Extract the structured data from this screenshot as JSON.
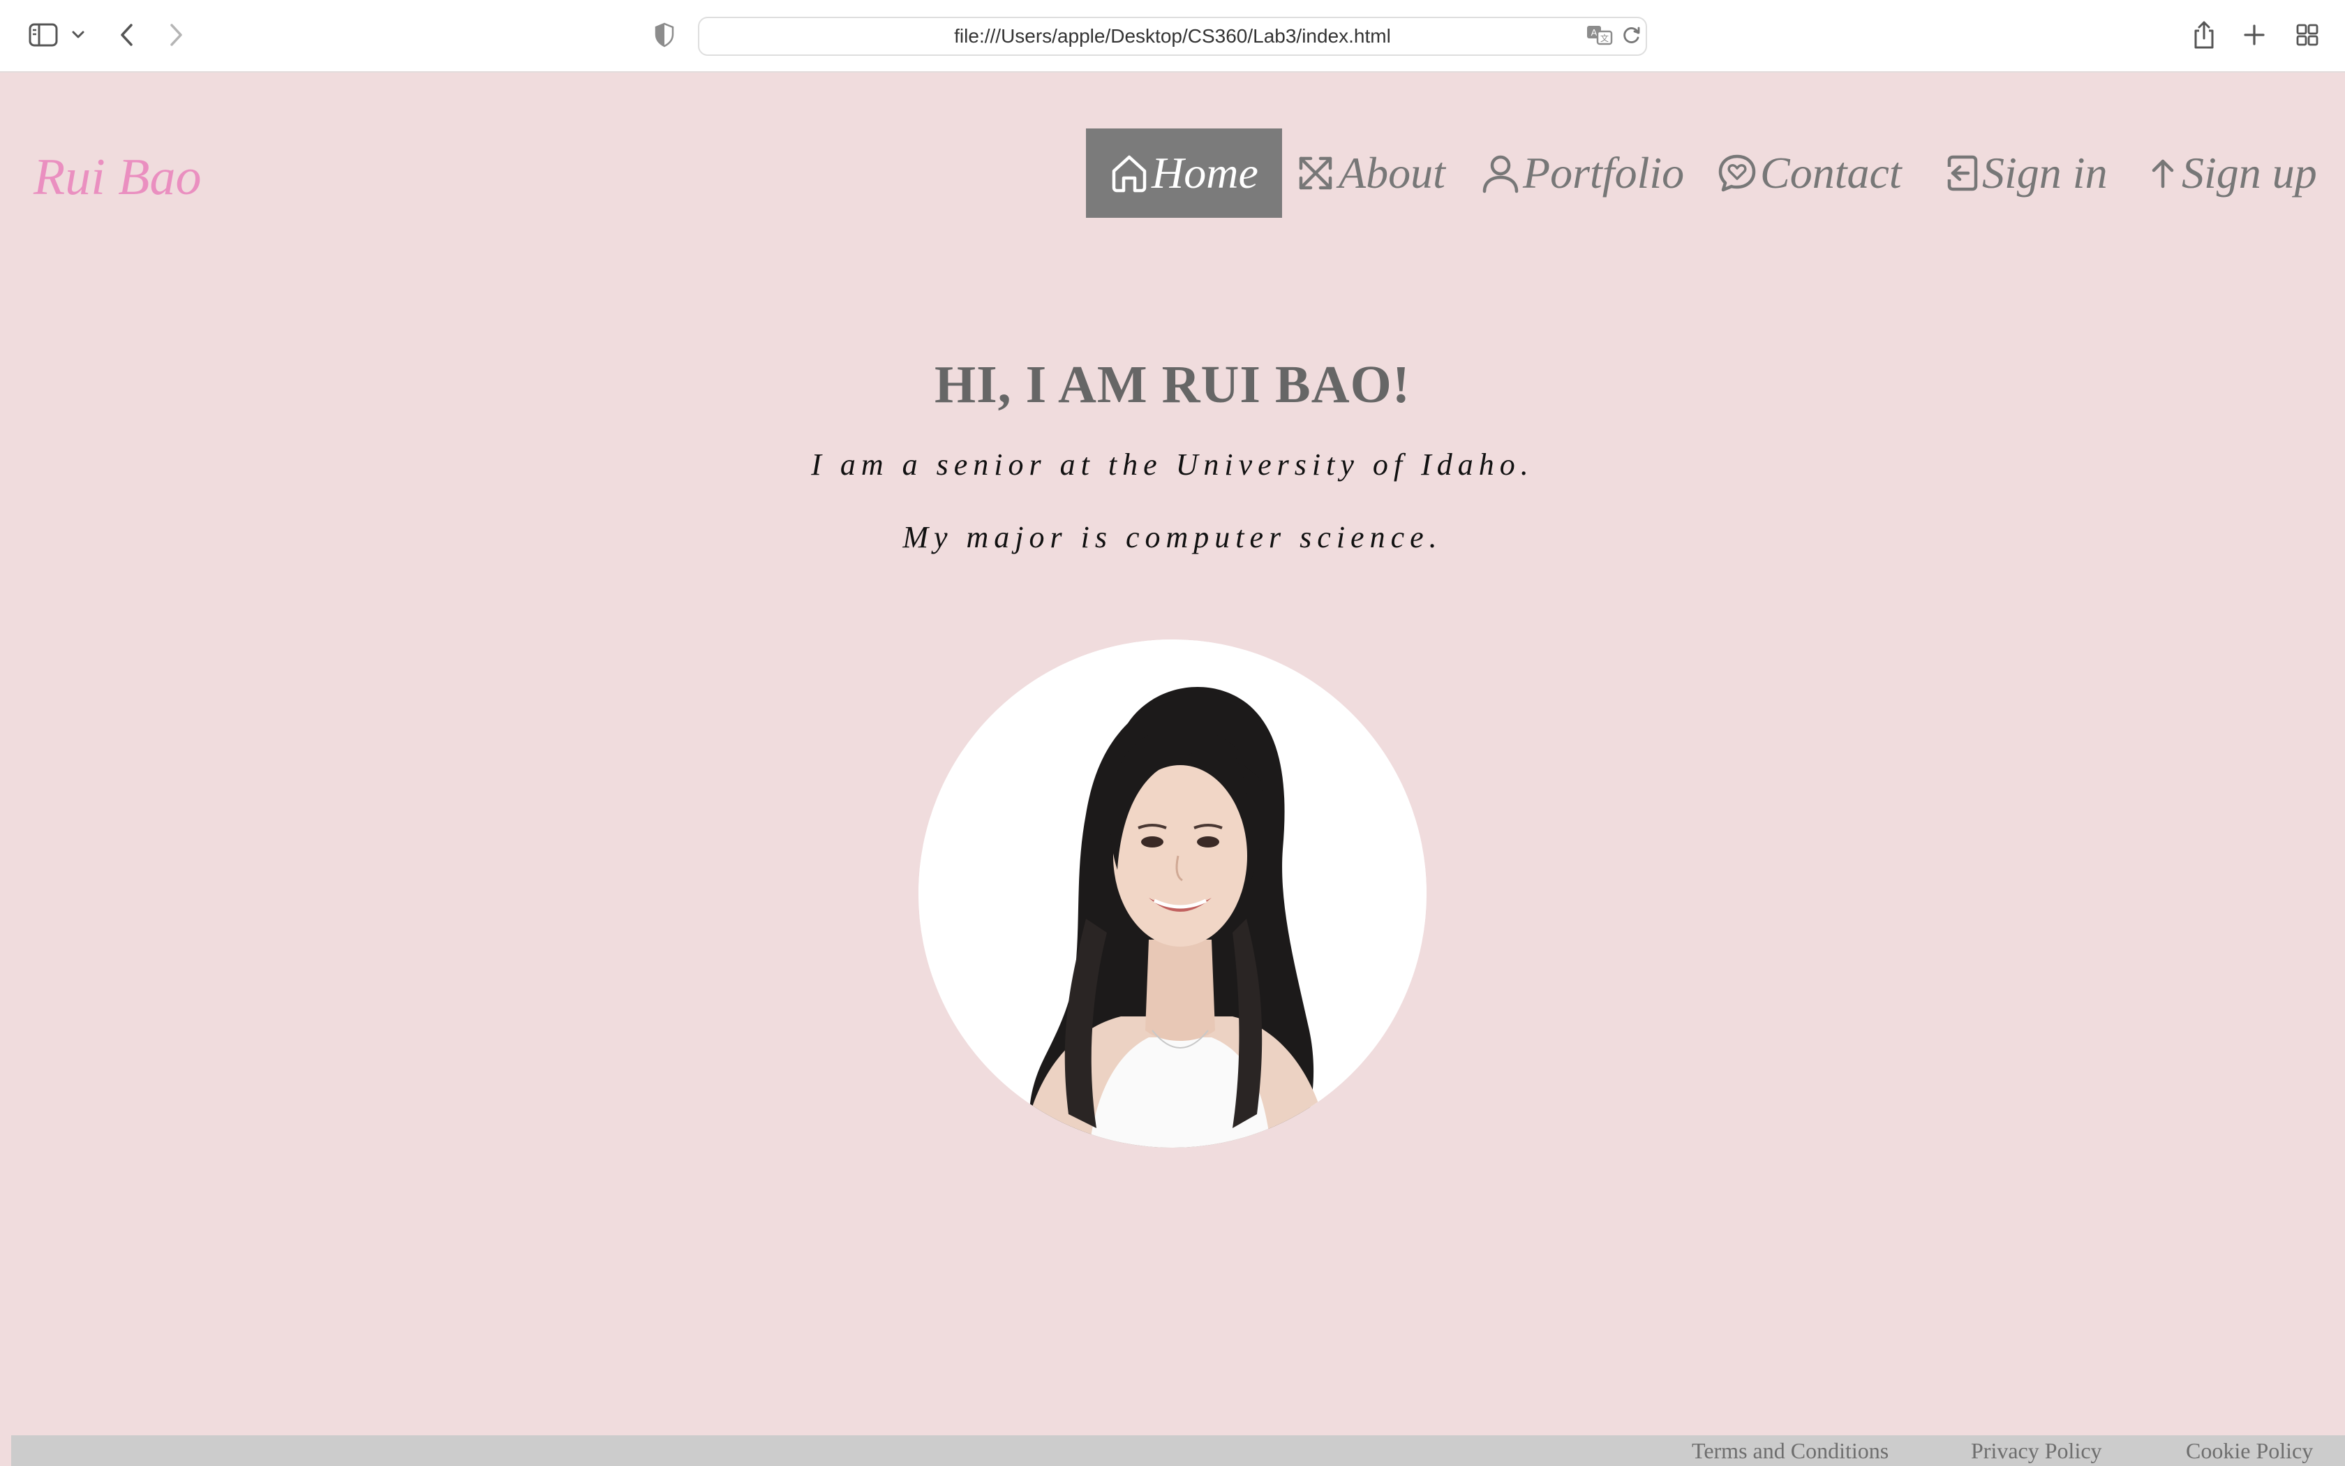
{
  "browser": {
    "url": "file:///Users/apple/Desktop/CS360/Lab3/index.html"
  },
  "brand": "Rui Bao",
  "nav": {
    "items": [
      {
        "label": "Home",
        "icon": "home-icon",
        "active": true
      },
      {
        "label": "About",
        "icon": "expand-icon",
        "active": false
      },
      {
        "label": "Portfolio",
        "icon": "person-icon",
        "active": false
      },
      {
        "label": "Contact",
        "icon": "chat-heart-icon",
        "active": false
      },
      {
        "label": "Sign in",
        "icon": "sign-in-icon",
        "active": false
      },
      {
        "label": "Sign up",
        "icon": "arrow-up-icon",
        "active": false
      }
    ]
  },
  "hero": {
    "title": "HI, I AM RUI BAO!",
    "line1": "I am a senior at the University of Idaho.",
    "line2": "My major is computer science."
  },
  "footer": {
    "links": [
      "Terms and Conditions",
      "Privacy Policy",
      "Cookie Policy"
    ]
  },
  "colors": {
    "page_background": "#f0dcdd",
    "brand": "#ea8fc0",
    "nav_text": "#777777",
    "nav_active_bg": "#7b7b7b",
    "footer_bg": "#cccccc"
  }
}
